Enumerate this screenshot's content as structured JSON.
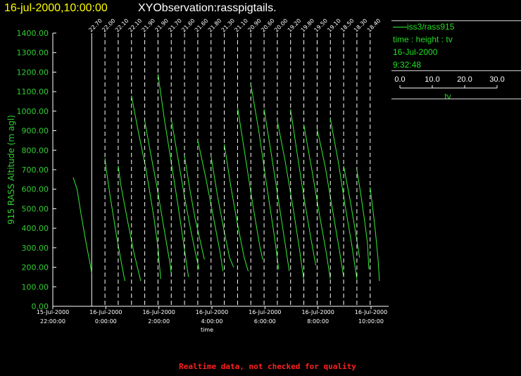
{
  "header": {
    "date_time": "16-jul-2000,10:00:00",
    "observation": "XYObservation:rasspigtails."
  },
  "legend": {
    "series": "iss3/rass915",
    "axes": "time : height : tv",
    "date": "16-Jul-2000",
    "time": "9:32:48",
    "scale_ticks": [
      "0.0",
      "10.0",
      "20.0",
      "30.0"
    ],
    "scale_label": "tv"
  },
  "footer": {
    "note": "Realtime data, not checked for quality"
  },
  "colors": {
    "trace": "#33ee33",
    "axis": "#ffffff",
    "ylabel": "#33cc33",
    "warning": "#ff2020",
    "title_date": "#ffff00"
  },
  "chart_data": {
    "type": "line",
    "ylabel": "915 RASS Altitude (m agl)",
    "xlabel": "time",
    "ylim": [
      0,
      1400
    ],
    "yticks": [
      "0.00",
      "100.00",
      "200.00",
      "300.00",
      "400.00",
      "500.00",
      "600.00",
      "700.00",
      "800.00",
      "900.00",
      "1000.00",
      "1100.00",
      "1200.00",
      "1300.00",
      "1400.00"
    ],
    "xlim": [
      "2000-07-15T22:00",
      "2000-07-16T10:00"
    ],
    "xticks": [
      {
        "date": "15-Jul-2000",
        "time": "22:00:00",
        "hour": 22
      },
      {
        "date": "16-Jul-2000",
        "time": "0:00:00",
        "hour": 24
      },
      {
        "date": "16-Jul-2000",
        "time": "2:00:00",
        "hour": 26
      },
      {
        "date": "16-Jul-2000",
        "time": "4:00:00",
        "hour": 28
      },
      {
        "date": "16-Jul-2000",
        "time": "6:00:00",
        "hour": 30
      },
      {
        "date": "16-Jul-2000",
        "time": "8:00:00",
        "hour": 32
      },
      {
        "date": "16-Jul-2000",
        "time": "10:00:00",
        "hour": 34
      }
    ],
    "pigtail_scale": "tv 0.0 to 30.0 per profile",
    "profiles": [
      {
        "time": "23:28",
        "label": "22.70",
        "pts": [
          [
            -0.7,
            660
          ],
          [
            -0.55,
            600
          ],
          [
            -0.4,
            470
          ],
          [
            -0.22,
            330
          ],
          [
            -0.05,
            210
          ],
          [
            0,
            170
          ]
        ],
        "solid": true
      },
      {
        "time": "23:58",
        "label": "22.00",
        "pts": [
          [
            0,
            760
          ],
          [
            0.05,
            700
          ],
          [
            0.2,
            560
          ],
          [
            0.45,
            350
          ],
          [
            0.65,
            200
          ],
          [
            0.75,
            130
          ]
        ]
      },
      {
        "time": "00:28",
        "label": "22.10",
        "pts": [
          [
            0,
            720
          ],
          [
            0.1,
            620
          ],
          [
            0.35,
            440
          ],
          [
            0.6,
            270
          ],
          [
            0.85,
            130
          ]
        ]
      },
      {
        "time": "00:58",
        "label": "22.10",
        "pts": [
          [
            0,
            1080
          ],
          [
            0.25,
            900
          ],
          [
            0.55,
            700
          ],
          [
            0.85,
            450
          ],
          [
            1.0,
            300
          ],
          [
            1.1,
            140
          ]
        ]
      },
      {
        "time": "01:28",
        "label": "21.90",
        "pts": [
          [
            0,
            950
          ],
          [
            0.2,
            800
          ],
          [
            0.45,
            620
          ],
          [
            0.7,
            420
          ],
          [
            0.95,
            220
          ],
          [
            1.0,
            170
          ]
        ]
      },
      {
        "time": "01:58",
        "label": "21.90",
        "pts": [
          [
            0,
            1190
          ],
          [
            0.25,
            950
          ],
          [
            0.5,
            740
          ],
          [
            0.75,
            520
          ],
          [
            1.0,
            290
          ],
          [
            1.15,
            150
          ]
        ]
      },
      {
        "time": "02:28",
        "label": "21.70",
        "pts": [
          [
            0,
            960
          ],
          [
            0.25,
            760
          ],
          [
            0.5,
            560
          ],
          [
            0.75,
            380
          ],
          [
            0.95,
            250
          ],
          [
            1.05,
            190
          ]
        ]
      },
      {
        "time": "02:58",
        "label": "21.60",
        "pts": [
          [
            0,
            770
          ],
          [
            0.2,
            600
          ],
          [
            0.4,
            450
          ],
          [
            0.6,
            330
          ],
          [
            0.75,
            240
          ]
        ]
      },
      {
        "time": "03:28",
        "label": "21.60",
        "pts": [
          [
            0,
            850
          ],
          [
            0.3,
            660
          ],
          [
            0.6,
            450
          ],
          [
            0.85,
            270
          ],
          [
            0.95,
            180
          ]
        ]
      },
      {
        "time": "03:58",
        "label": "21.80",
        "pts": [
          [
            0,
            770
          ],
          [
            0.25,
            560
          ],
          [
            0.5,
            380
          ],
          [
            0.7,
            250
          ],
          [
            0.85,
            200
          ]
        ]
      },
      {
        "time": "04:28",
        "label": "21.30",
        "pts": [
          [
            0,
            830
          ],
          [
            0.25,
            610
          ],
          [
            0.5,
            420
          ],
          [
            0.75,
            250
          ],
          [
            0.9,
            180
          ]
        ]
      },
      {
        "time": "04:58",
        "label": "21.10",
        "pts": [
          [
            0,
            1020
          ],
          [
            0.3,
            760
          ],
          [
            0.6,
            500
          ],
          [
            0.85,
            300
          ],
          [
            0.95,
            240
          ]
        ]
      },
      {
        "time": "05:28",
        "label": "20.90",
        "pts": [
          [
            0,
            1140
          ],
          [
            0.3,
            900
          ],
          [
            0.6,
            620
          ],
          [
            0.9,
            350
          ],
          [
            1.05,
            190
          ]
        ]
      },
      {
        "time": "05:58",
        "label": "20.60",
        "pts": [
          [
            0,
            1010
          ],
          [
            0.25,
            800
          ],
          [
            0.5,
            580
          ],
          [
            0.75,
            360
          ],
          [
            0.95,
            180
          ]
        ]
      },
      {
        "time": "06:28",
        "label": "20.00",
        "pts": [
          [
            0,
            950
          ],
          [
            0.3,
            740
          ],
          [
            0.6,
            500
          ],
          [
            0.85,
            280
          ],
          [
            1.0,
            130
          ]
        ]
      },
      {
        "time": "06:58",
        "label": "19.20",
        "pts": [
          [
            0,
            1010
          ],
          [
            0.25,
            780
          ],
          [
            0.5,
            560
          ],
          [
            0.75,
            360
          ],
          [
            0.95,
            210
          ]
        ]
      },
      {
        "time": "07:28",
        "label": "19.80",
        "pts": [
          [
            0,
            930
          ],
          [
            0.3,
            700
          ],
          [
            0.6,
            460
          ],
          [
            0.85,
            270
          ],
          [
            1.0,
            140
          ]
        ]
      },
      {
        "time": "07:58",
        "label": "19.50",
        "pts": [
          [
            0,
            910
          ],
          [
            0.3,
            720
          ],
          [
            0.6,
            480
          ],
          [
            0.85,
            280
          ],
          [
            1.0,
            150
          ]
        ]
      },
      {
        "time": "08:28",
        "label": "19.10",
        "pts": [
          [
            0,
            960
          ],
          [
            0.3,
            740
          ],
          [
            0.55,
            520
          ],
          [
            0.8,
            320
          ],
          [
            1.0,
            140
          ]
        ]
      },
      {
        "time": "08:58",
        "label": "18.50",
        "pts": [
          [
            0,
            720
          ],
          [
            0.25,
            540
          ],
          [
            0.45,
            380
          ],
          [
            0.6,
            250
          ]
        ]
      },
      {
        "time": "09:28",
        "label": "18.30",
        "pts": [
          [
            0,
            700
          ],
          [
            0.15,
            570
          ],
          [
            0.3,
            430
          ],
          [
            0.4,
            320
          ],
          [
            0.45,
            190
          ]
        ]
      },
      {
        "time": "09:58",
        "label": "18.40",
        "pts": [
          [
            0,
            610
          ],
          [
            0.1,
            500
          ],
          [
            0.2,
            380
          ],
          [
            0.3,
            240
          ],
          [
            0.35,
            130
          ]
        ]
      }
    ]
  }
}
